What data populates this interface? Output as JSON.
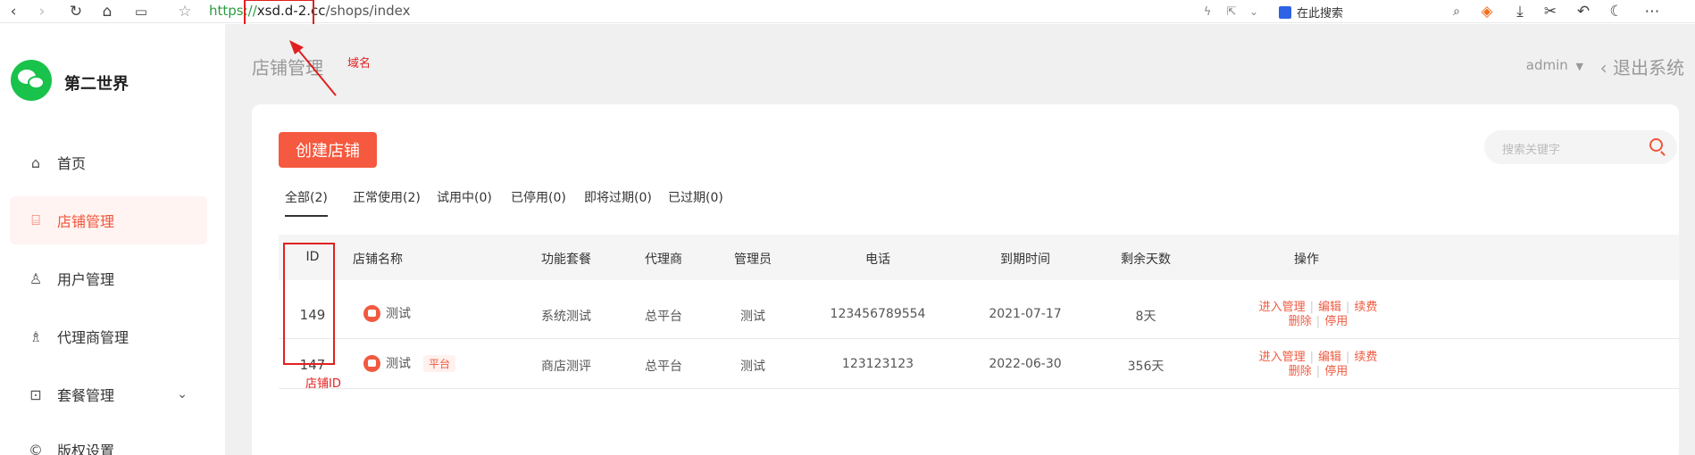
{
  "browser": {
    "url_scheme": "https://",
    "url_domain": "xsd.d-2.cc",
    "url_path": "/shops/index",
    "search_engine_label": "在此搜索"
  },
  "sidebar": {
    "brand": "第二世界",
    "items": [
      {
        "label": "首页",
        "icon": "home-icon"
      },
      {
        "label": "店铺管理",
        "icon": "store-icon"
      },
      {
        "label": "用户管理",
        "icon": "user-icon"
      },
      {
        "label": "代理商管理",
        "icon": "agent-icon"
      },
      {
        "label": "套餐管理",
        "icon": "package-icon"
      },
      {
        "label": "版权设置",
        "icon": "copyright-icon"
      }
    ]
  },
  "header": {
    "title": "店铺管理",
    "user": "admin",
    "logout": "退出系统"
  },
  "annotations": {
    "domain_label": "域名",
    "id_label": "店铺ID"
  },
  "toolbar": {
    "create_label": "创建店铺",
    "search_placeholder": "搜索关键字"
  },
  "tabs": [
    {
      "label": "全部(2)"
    },
    {
      "label": "正常使用(2)"
    },
    {
      "label": "试用中(0)"
    },
    {
      "label": "已停用(0)"
    },
    {
      "label": "即将过期(0)"
    },
    {
      "label": "已过期(0)"
    }
  ],
  "table": {
    "columns": [
      "ID",
      "店铺名称",
      "功能套餐",
      "代理商",
      "管理员",
      "电话",
      "到期时间",
      "剩余天数",
      "操作"
    ],
    "rows": [
      {
        "id": "149",
        "name": "测试",
        "badge": "",
        "package": "系统测试",
        "agent": "总平台",
        "admin": "测试",
        "phone": "123456789554",
        "expire": "2021-07-17",
        "days": "8天"
      },
      {
        "id": "147",
        "name": "测试",
        "badge": "平台",
        "package": "商店测评",
        "agent": "总平台",
        "admin": "测试",
        "phone": "123123123",
        "expire": "2022-06-30",
        "days": "356天"
      }
    ],
    "actions": {
      "enter": "进入管理",
      "edit": "编辑",
      "renew": "续费",
      "delete": "删除",
      "disable": "停用"
    }
  }
}
